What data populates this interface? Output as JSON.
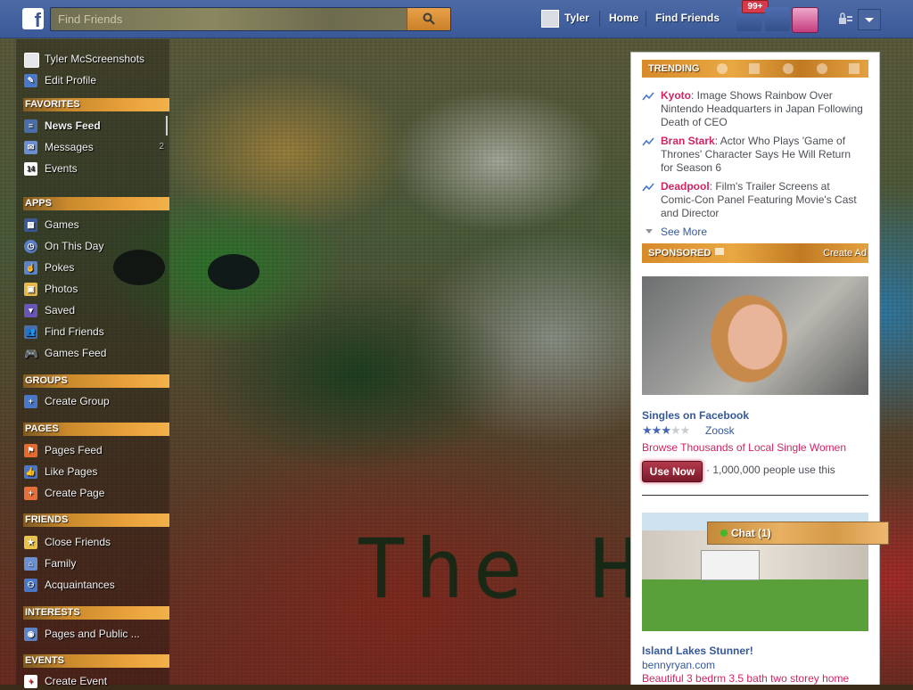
{
  "search": {
    "placeholder": "Find Friends"
  },
  "nav": {
    "user_name": "Tyler",
    "home": "Home",
    "find_friends": "Find Friends",
    "notification_count": "99+"
  },
  "sidebar": {
    "profile_name": "Tyler McScreenshots",
    "edit_profile": "Edit Profile",
    "favorites": {
      "header": "FAVORITES",
      "items": [
        {
          "label": "News Feed",
          "count": ""
        },
        {
          "label": "Messages",
          "count": "2"
        },
        {
          "label": "Events",
          "count": ""
        }
      ]
    },
    "apps": {
      "header": "APPS",
      "items": [
        "Games",
        "On This Day",
        "Pokes",
        "Photos",
        "Saved",
        "Find Friends",
        "Games Feed"
      ]
    },
    "groups": {
      "header": "GROUPS",
      "items": [
        "Create Group"
      ]
    },
    "pages": {
      "header": "PAGES",
      "items": [
        "Pages Feed",
        "Like Pages",
        "Create Page"
      ]
    },
    "friends": {
      "header": "FRIENDS",
      "items": [
        "Close Friends",
        "Family",
        "Acquaintances"
      ]
    },
    "interests": {
      "header": "INTERESTS",
      "items": [
        "Pages and Public ..."
      ]
    },
    "events": {
      "header": "EVENTS",
      "items": [
        "Create Event"
      ]
    }
  },
  "trending": {
    "header": "TRENDING",
    "items": [
      {
        "topic": "Kyoto",
        "text": ": Image Shows Rainbow Over Nintendo Headquarters in Japan Following Death of CEO"
      },
      {
        "topic": "Bran Stark",
        "text": ": Actor Who Plays 'Game of Thrones' Character Says He Will Return for Season 6"
      },
      {
        "topic": "Deadpool",
        "text": ": Film's Trailer Screens at Comic-Con Panel Featuring Movie's Cast and Director"
      }
    ],
    "see_more": "See More"
  },
  "sponsored": {
    "header": "SPONSORED",
    "create_ad": "Create Ad",
    "ads": [
      {
        "title": "Singles on Facebook",
        "rating": 2.5,
        "source": "Zoosk",
        "description": "Browse Thousands of Local Single Women",
        "button": "Use Now",
        "social": "· 1,000,000 people use this"
      },
      {
        "title": "Island Lakes Stunner!",
        "source": "bennyryan.com",
        "description": "Beautiful 3 bedrm 3.5 bath two storey home"
      }
    ]
  },
  "chat": {
    "label": "Chat",
    "count": "(1)"
  },
  "background_text": "The Ha"
}
